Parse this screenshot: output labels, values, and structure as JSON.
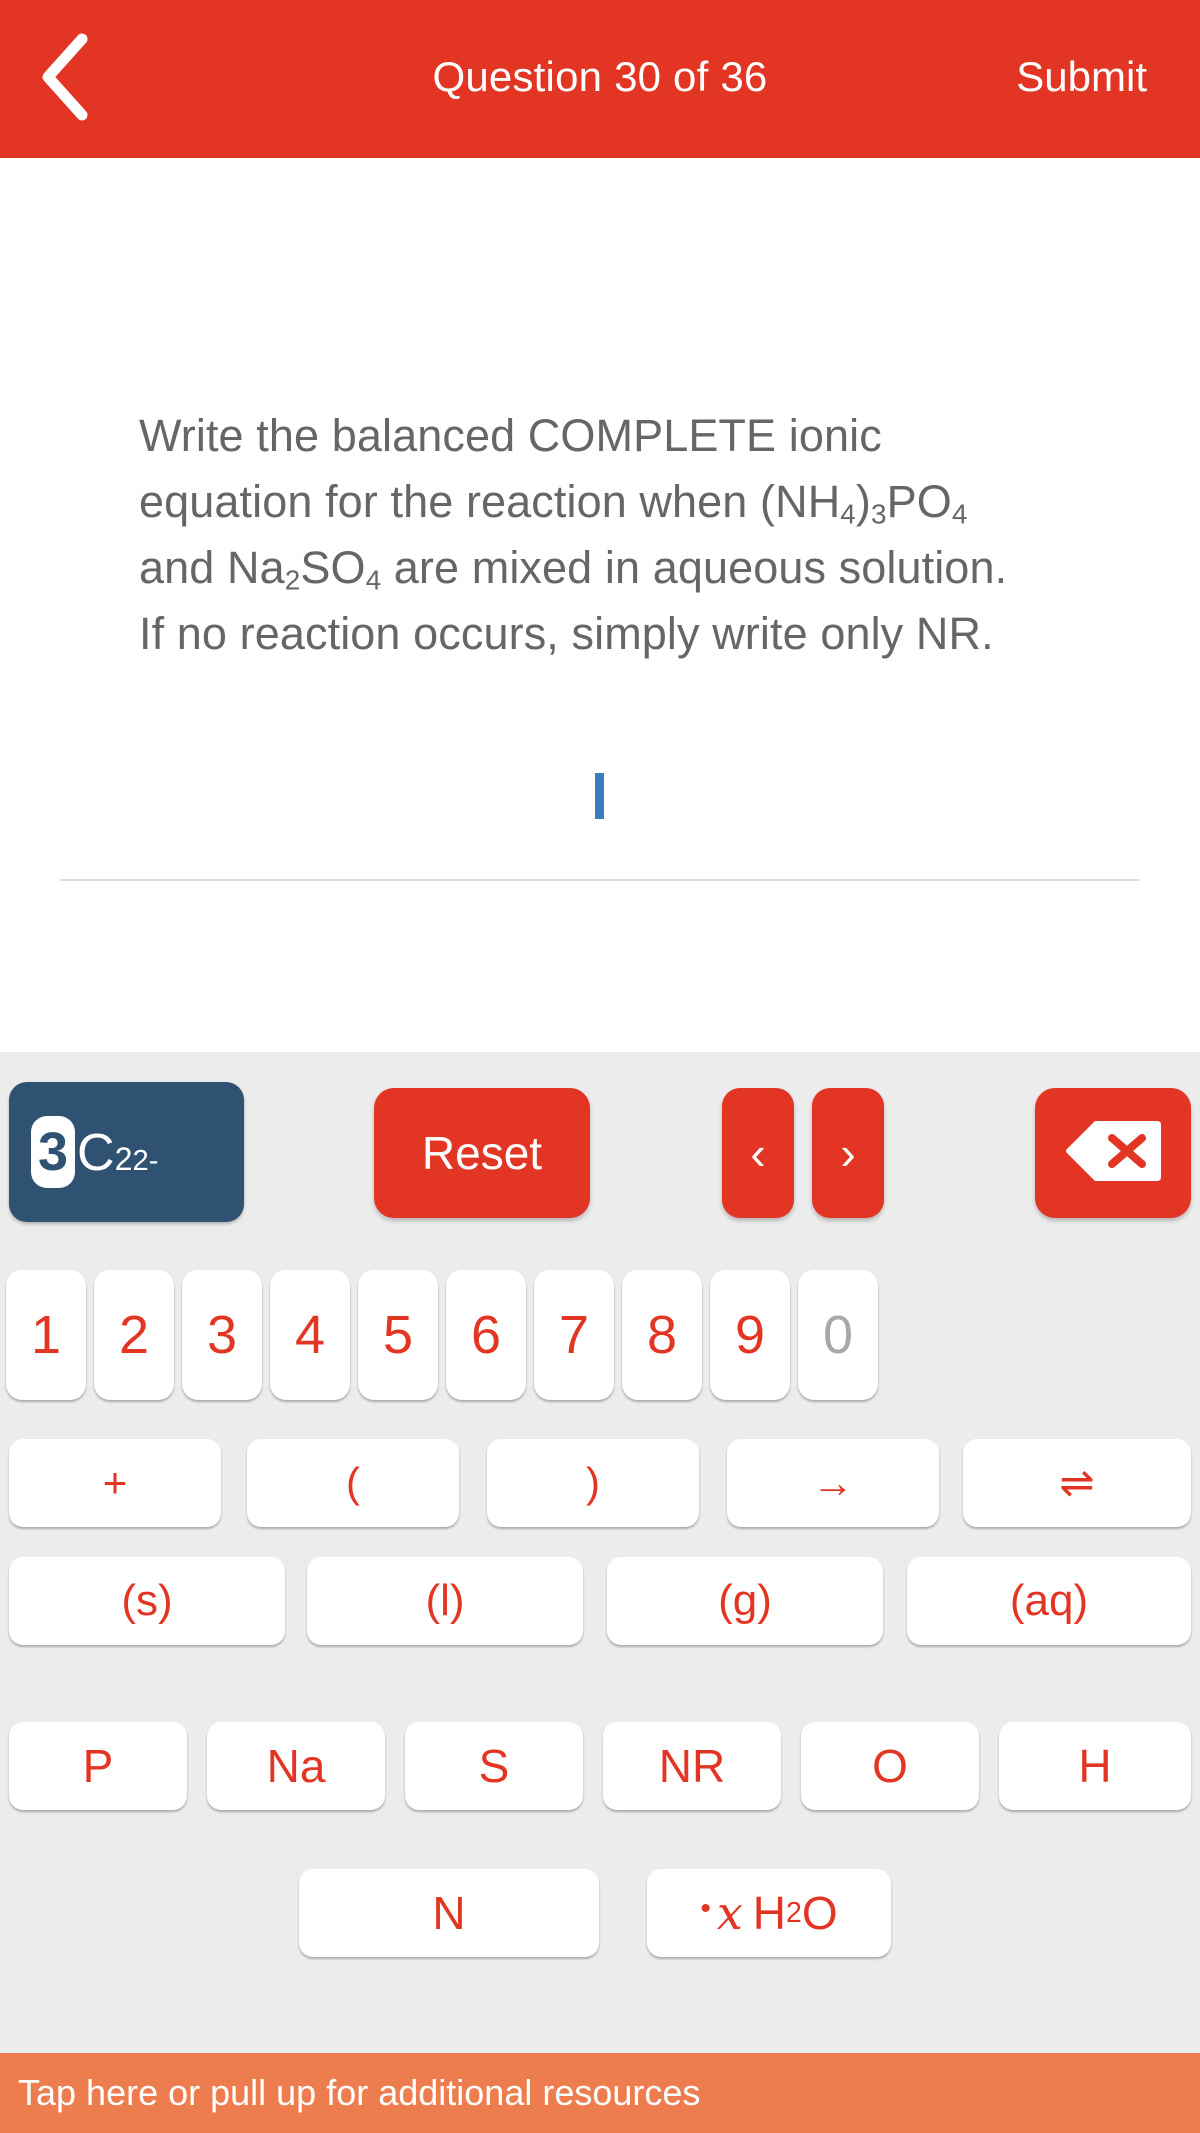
{
  "header": {
    "back_icon": "chevron-left-icon",
    "title": "Question 30 of 36",
    "submit_label": "Submit",
    "background_color": "#E33524"
  },
  "question": {
    "text_plain": "Write the balanced COMPLETE ionic equation for the reaction when (NH4)3PO4 and Na2SO4 are mixed in aqueous solution. If no reaction occurs, simply write only NR.",
    "segments": [
      {
        "t": "Write the balanced COMPLETE ionic equation for the reaction when (NH",
        "sub": false
      },
      {
        "t": "4",
        "sub": true
      },
      {
        "t": ")",
        "sub": false
      },
      {
        "t": "3",
        "sub": true
      },
      {
        "t": "PO",
        "sub": false
      },
      {
        "t": "4",
        "sub": true
      },
      {
        "t": " and Na",
        "sub": false
      },
      {
        "t": "2",
        "sub": true
      },
      {
        "t": "SO",
        "sub": false
      },
      {
        "t": "4",
        "sub": true
      },
      {
        "t": " are mixed in aqueous solution. If no reaction occurs, simply write only NR.",
        "sub": false
      }
    ],
    "text_color": "#666666"
  },
  "answer": {
    "value": "",
    "caret_color": "#3A7BBF"
  },
  "keyboard": {
    "background_color": "#ECECEC",
    "accent_color": "#E33524",
    "format_key": {
      "coefficient": "3",
      "element": "C",
      "subscript": "2",
      "superscript": "2-",
      "background_color": "#2F5272"
    },
    "reset_label": "Reset",
    "nav_prev_icon": "chevron-left-icon",
    "nav_prev_glyph": "‹",
    "nav_next_icon": "chevron-right-icon",
    "nav_next_glyph": "›",
    "backspace_icon": "backspace-delete-icon",
    "digits": [
      {
        "label": "1",
        "disabled": false
      },
      {
        "label": "2",
        "disabled": false
      },
      {
        "label": "3",
        "disabled": false
      },
      {
        "label": "4",
        "disabled": false
      },
      {
        "label": "5",
        "disabled": false
      },
      {
        "label": "6",
        "disabled": false
      },
      {
        "label": "7",
        "disabled": false
      },
      {
        "label": "8",
        "disabled": false
      },
      {
        "label": "9",
        "disabled": false
      },
      {
        "label": "0",
        "disabled": true
      }
    ],
    "operators": [
      {
        "label": "+",
        "name": "plus"
      },
      {
        "label": "(",
        "name": "open-paren"
      },
      {
        "label": ")",
        "name": "close-paren"
      },
      {
        "label": "→",
        "name": "yields-arrow"
      },
      {
        "label": "⇌",
        "name": "equilibrium-arrow"
      }
    ],
    "states": [
      {
        "label": "(s)",
        "name": "solid"
      },
      {
        "label": "(l)",
        "name": "liquid"
      },
      {
        "label": "(g)",
        "name": "gas"
      },
      {
        "label": "(aq)",
        "name": "aqueous"
      }
    ],
    "elements": [
      {
        "label": "P",
        "name": "p"
      },
      {
        "label": "Na",
        "name": "na"
      },
      {
        "label": "S",
        "name": "s"
      },
      {
        "label": "NR",
        "name": "nr"
      },
      {
        "label": "O",
        "name": "o"
      },
      {
        "label": "H",
        "name": "h"
      }
    ],
    "extra": [
      {
        "label": "N",
        "name": "n"
      }
    ],
    "hydrate": {
      "dot": "•",
      "variable": "x",
      "formula": "H",
      "subscript": "2",
      "suffix": "O"
    }
  },
  "resources_bar": {
    "label": "Tap here or pull up for additional resources",
    "background_color": "#ED7D4E"
  }
}
